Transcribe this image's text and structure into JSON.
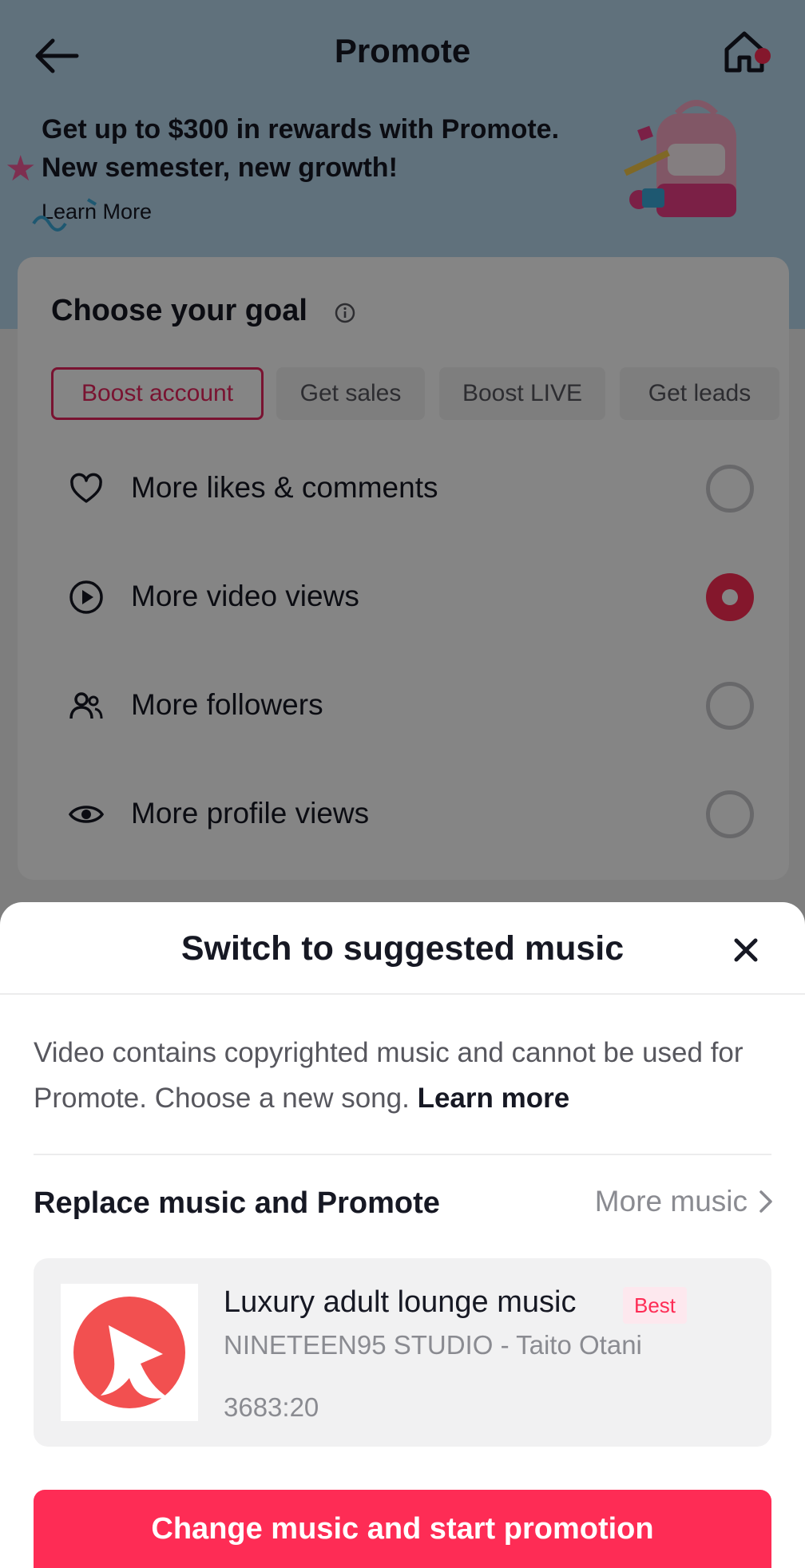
{
  "header": {
    "title": "Promote"
  },
  "banner": {
    "headline": "Get up to $300 in rewards with Promote. New semester, new growth!",
    "link": "Learn More"
  },
  "goal": {
    "title": "Choose your goal",
    "tabs": [
      {
        "label": "Boost account",
        "active": true
      },
      {
        "label": "Get sales",
        "active": false
      },
      {
        "label": "Boost LIVE",
        "active": false
      },
      {
        "label": "Get leads",
        "active": false
      }
    ],
    "options": [
      {
        "label": "More likes & comments",
        "icon": "heart-icon",
        "selected": false
      },
      {
        "label": "More video views",
        "icon": "play-circle-icon",
        "selected": true
      },
      {
        "label": "More followers",
        "icon": "people-icon",
        "selected": false
      },
      {
        "label": "More profile views",
        "icon": "eye-icon",
        "selected": false
      }
    ]
  },
  "sheet": {
    "title": "Switch to suggested music",
    "notice_text": "Video contains copyrighted music and cannot be used for Promote. Choose a new song. ",
    "notice_link": "Learn more",
    "section_title": "Replace music and Promote",
    "more_music": "More music",
    "song": {
      "title": "Luxury adult lounge music",
      "badge": "Best",
      "artist": "NINETEEN95 STUDIO - Taito Otani",
      "duration": "3683:20"
    },
    "cta": "Change music and start promotion"
  },
  "colors": {
    "accent": "#fe2c55",
    "hero_background": "#b8d8ee"
  }
}
